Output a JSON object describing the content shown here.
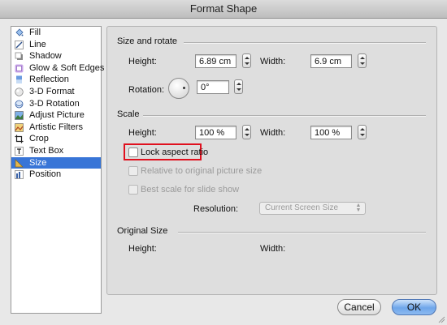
{
  "window": {
    "title": "Format Shape"
  },
  "sidebar": {
    "items": [
      {
        "label": "Fill",
        "icon": "paint-bucket-icon",
        "selected": false
      },
      {
        "label": "Line",
        "icon": "line-icon",
        "selected": false
      },
      {
        "label": "Shadow",
        "icon": "shadow-icon",
        "selected": false
      },
      {
        "label": "Glow & Soft Edges",
        "icon": "glow-icon",
        "selected": false
      },
      {
        "label": "Reflection",
        "icon": "reflection-icon",
        "selected": false
      },
      {
        "label": "3-D Format",
        "icon": "3d-format-icon",
        "selected": false
      },
      {
        "label": "3-D Rotation",
        "icon": "3d-rotation-icon",
        "selected": false
      },
      {
        "label": "Adjust Picture",
        "icon": "adjust-picture-icon",
        "selected": false
      },
      {
        "label": "Artistic Filters",
        "icon": "artistic-filters-icon",
        "selected": false
      },
      {
        "label": "Crop",
        "icon": "crop-icon",
        "selected": false
      },
      {
        "label": "Text Box",
        "icon": "text-box-icon",
        "selected": false
      },
      {
        "label": "Size",
        "icon": "size-icon",
        "selected": true
      },
      {
        "label": "Position",
        "icon": "position-icon",
        "selected": false
      }
    ]
  },
  "size_rotate": {
    "title": "Size and rotate",
    "height_label": "Height:",
    "height_value": "6.89 cm",
    "width_label": "Width:",
    "width_value": "6.9 cm",
    "rotation_label": "Rotation:",
    "rotation_value": "0°"
  },
  "scale": {
    "title": "Scale",
    "height_label": "Height:",
    "height_value": "100 %",
    "width_label": "Width:",
    "width_value": "100 %",
    "lock_aspect_label": "Lock aspect ratio",
    "relative_label": "Relative to original picture size",
    "best_scale_label": "Best scale for slide show",
    "resolution_label": "Resolution:",
    "resolution_value": "Current Screen Size"
  },
  "original_size": {
    "title": "Original Size",
    "height_label": "Height:",
    "width_label": "Width:"
  },
  "buttons": {
    "cancel": "Cancel",
    "ok": "OK"
  },
  "colors": {
    "selection": "#3875d7",
    "highlight": "#e0101e",
    "ok_button": "#6ea6ea"
  }
}
